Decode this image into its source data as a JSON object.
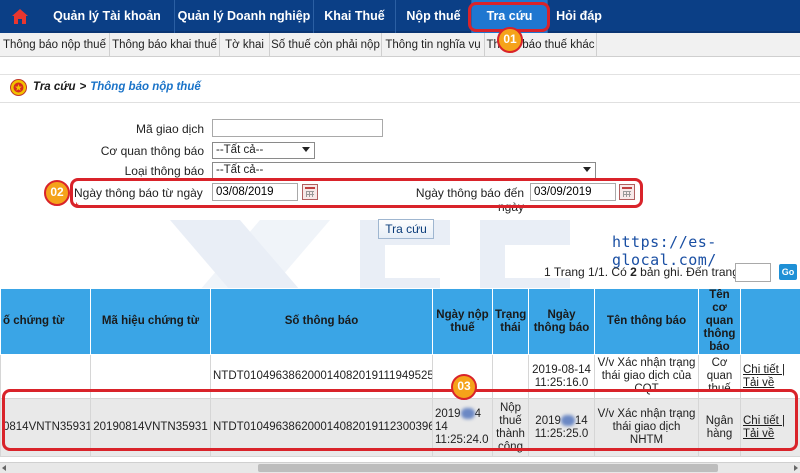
{
  "topnav": {
    "home_icon": "home-icon",
    "items": [
      {
        "label": "Quản lý Tài khoản",
        "active": false
      },
      {
        "label": "Quản lý Doanh nghiệp",
        "active": false
      },
      {
        "label": "Khai Thuế",
        "active": false
      },
      {
        "label": "Nộp thuế",
        "active": false
      },
      {
        "label": "Tra cứu",
        "active": true
      },
      {
        "label": "Hỏi đáp",
        "active": false
      }
    ]
  },
  "subnav": {
    "items": [
      {
        "label": "Thông báo nộp thuế"
      },
      {
        "label": "Thông báo khai thuế"
      },
      {
        "label": "Tờ khai"
      },
      {
        "label": "Số thuế còn phải nộp"
      },
      {
        "label": "Thông tin nghĩa vụ"
      },
      {
        "label": "Thông báo thuế khác"
      }
    ]
  },
  "breadcrumb": {
    "root": "Tra cứu",
    "separator": ">",
    "current": "Thông báo nộp thuế"
  },
  "form": {
    "ma_giao_dich": {
      "label": "Mã giao dịch",
      "value": ""
    },
    "co_quan": {
      "label": "Cơ quan thông báo",
      "value": "--Tất cả--"
    },
    "loai": {
      "label": "Loại thông báo",
      "value": "--Tất cả--"
    },
    "from_date": {
      "label": "Ngày thông báo từ ngày",
      "required_mark": "*",
      "value": "03/08/2019"
    },
    "to_date": {
      "label": "Ngày thông báo đến ngày",
      "value": "03/09/2019"
    },
    "search_label": "Tra cứu"
  },
  "watermark_url": "https://es-glocal.com/",
  "pager": {
    "prefix": "1",
    "page_text": "Trang 1/1.",
    "count_pre": "Có",
    "count": "2",
    "count_post": "bản ghi. Đến trang",
    "go_label": "Go"
  },
  "table": {
    "headers": [
      "ố chứng từ",
      "Mã hiệu chứng từ",
      "Số thông báo",
      "Ngày nộp thuế",
      "Trạng thái",
      "Ngày thông báo",
      "Tên thông báo",
      "Tên cơ quan thông báo",
      ""
    ],
    "rows": [
      {
        "so_chung_tu": "",
        "ma_hieu": "",
        "so_thong_bao": "NTDT010496386200014082019111949525",
        "ngay_nop": "",
        "trang_thai": "",
        "ngay_tb_date": "2019-08-14",
        "ngay_tb_time": "11:25:16.0",
        "ten_tb": "V/v Xác nhận trạng thái giao dịch của CQT",
        "co_quan": "Cơ quan thuế",
        "link1": "Chi tiết |",
        "link2": "Tải về"
      },
      {
        "so_chung_tu": "0814VNTN35931",
        "ma_hieu": "20190814VNTN35931",
        "so_thong_bao": "NTDT010496386200014082019112300396",
        "ngay_nop_a": "2019",
        "ngay_nop_b": "4",
        "ngay_nop_c": "14",
        "ngay_nop_time": "11:25:24.0",
        "trang_thai": "Nộp thuế thành công",
        "ngay_tb_a": "2019",
        "ngay_tb_b": "14",
        "ngay_tb_time": "11:25:25.0",
        "ten_tb": "V/v Xác nhận trạng thái giao dịch NHTM",
        "co_quan": "Ngân hàng",
        "link1": "Chi tiết |",
        "link2": "Tải về"
      }
    ]
  },
  "annotations": {
    "badge1": "01",
    "badge2": "02",
    "badge3": "03",
    "color": "#d9232a",
    "badge_color": "#f5a31a"
  }
}
